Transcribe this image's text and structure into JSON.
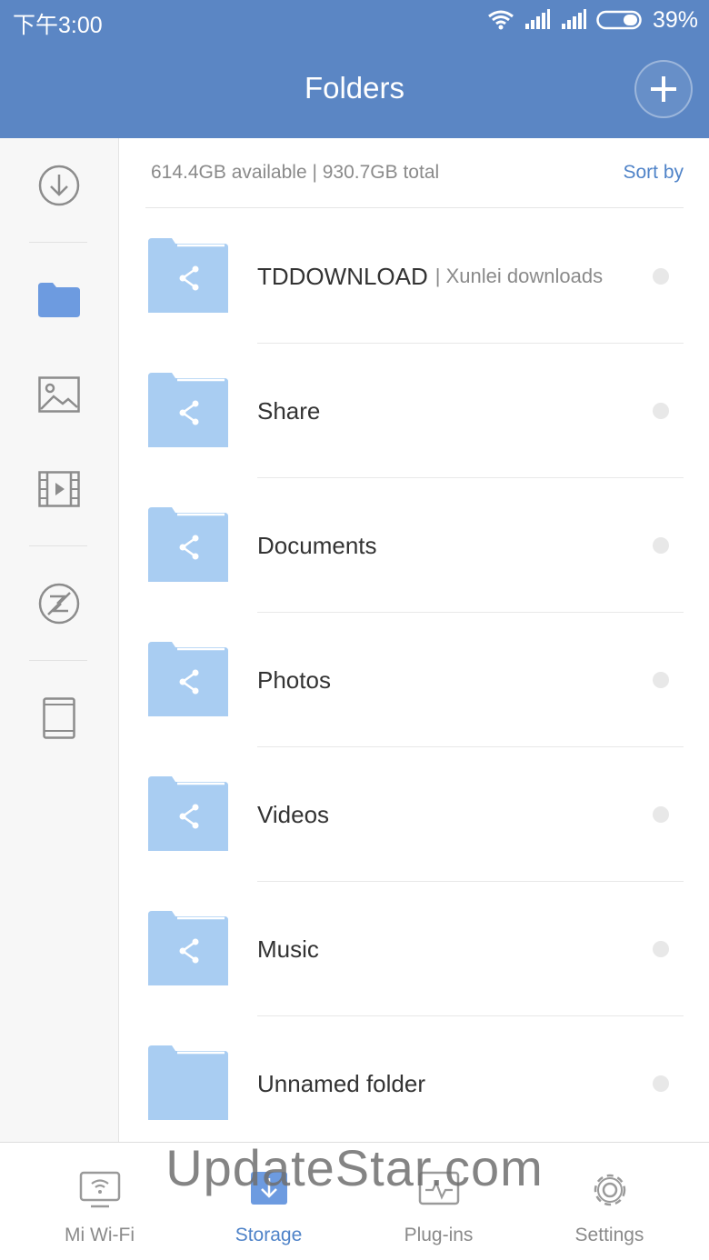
{
  "status_bar": {
    "time": "下午3:00",
    "battery": "39%"
  },
  "header": {
    "title": "Folders"
  },
  "sidebar": {
    "items": [
      {
        "icon": "download-icon"
      },
      {
        "icon": "folder-icon",
        "selected": true
      },
      {
        "icon": "image-icon"
      },
      {
        "icon": "video-icon"
      },
      {
        "icon": "no-sync-icon"
      },
      {
        "icon": "tablet-icon"
      }
    ]
  },
  "storage": {
    "info": "614.4GB available | 930.7GB total",
    "sort_label": "Sort by"
  },
  "folders": [
    {
      "name": "TDDOWNLOAD",
      "sub": "| Xunlei downloads",
      "shared": true
    },
    {
      "name": "Share",
      "shared": true
    },
    {
      "name": "Documents",
      "shared": true
    },
    {
      "name": "Photos",
      "shared": true
    },
    {
      "name": "Videos",
      "shared": true
    },
    {
      "name": "Music",
      "shared": true
    },
    {
      "name": "Unnamed folder",
      "shared": false
    }
  ],
  "bottom_nav": [
    {
      "label": "Mi Wi-Fi",
      "icon": "router-icon"
    },
    {
      "label": "Storage",
      "icon": "storage-download-icon",
      "active": true
    },
    {
      "label": "Plug-ins",
      "icon": "plugins-icon"
    },
    {
      "label": "Settings",
      "icon": "gear-icon"
    }
  ],
  "watermark": "UpdateStar.com",
  "colors": {
    "accent": "#5b86c4",
    "folder": "#a9cdf2",
    "link": "#4f83c8"
  }
}
